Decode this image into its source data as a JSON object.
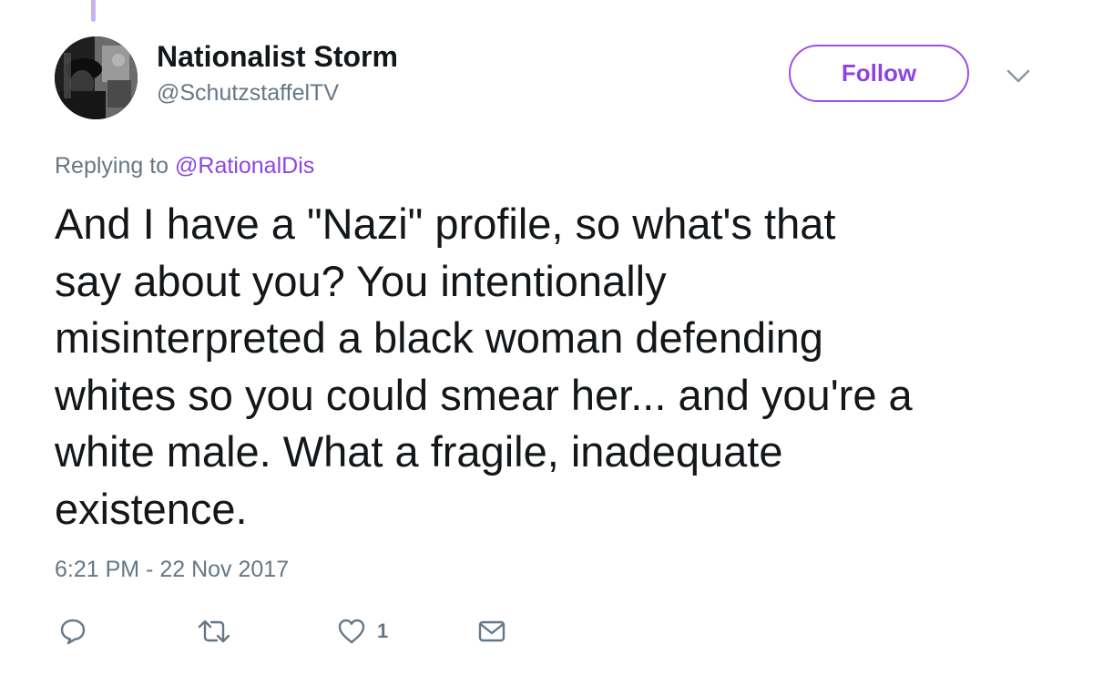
{
  "author": {
    "display_name": "Nationalist Storm",
    "handle": "@SchutzstaffelTV"
  },
  "header": {
    "follow_label": "Follow",
    "menu_icon": "chevron-down-icon"
  },
  "reply": {
    "prefix": "Replying to",
    "mention": "@RationalDis"
  },
  "tweet": {
    "lines": [
      "And I have a \"Nazi\" profile, so what's that",
      "say about you? You intentionally",
      "misinterpreted a black woman defending",
      "whites so you could smear her... and you're a",
      "white male. What a fragile, inadequate",
      "existence."
    ],
    "timestamp": "6:21 PM - 22 Nov 2017"
  },
  "actions": {
    "reply_icon": "reply-icon",
    "retweet_icon": "retweet-icon",
    "like_icon": "heart-icon",
    "like_count": "1",
    "dm_icon": "envelope-icon"
  },
  "colors": {
    "accent": "#8e45e0",
    "thread_line": "#c9b3ea",
    "text_primary": "#14171a",
    "text_secondary": "#657786"
  }
}
